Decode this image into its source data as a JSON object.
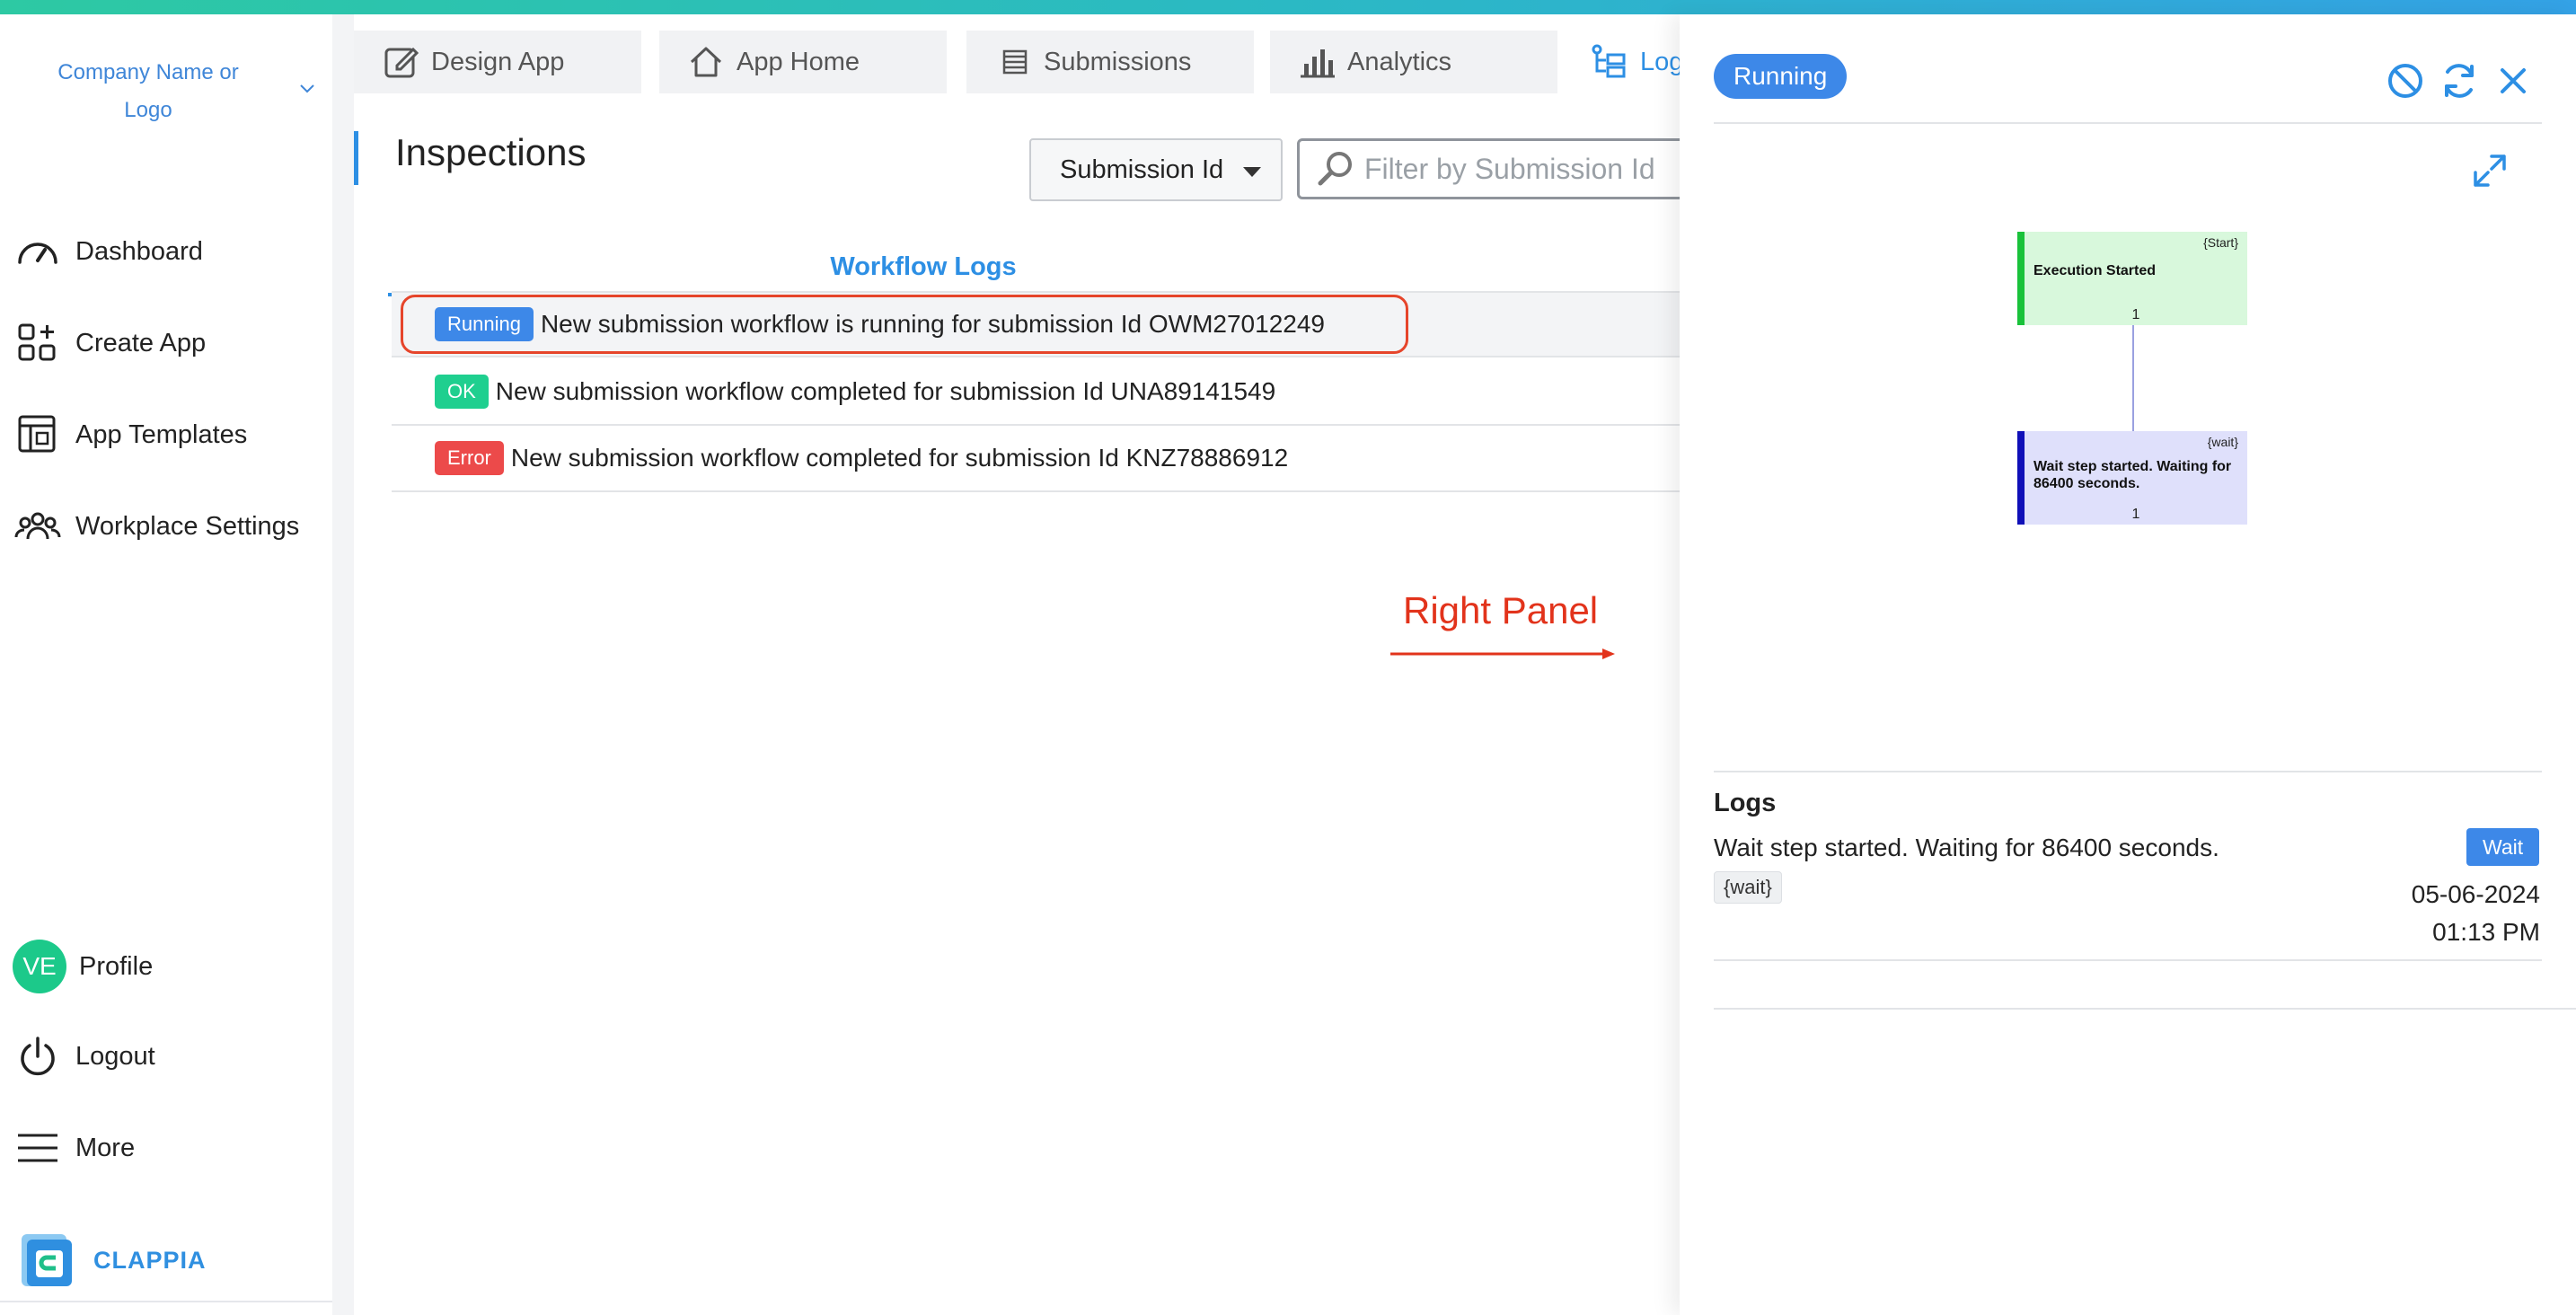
{
  "colors": {
    "accent": "#2d8fe4",
    "running": "#3d88e8",
    "ok": "#1fcf8f",
    "error": "#ec4a4a",
    "annotation": "#e2331b",
    "brand": "#2f8fe0"
  },
  "sidebar": {
    "company": "Company Name or Logo",
    "items": [
      {
        "label": "Dashboard",
        "icon": "gauge-icon"
      },
      {
        "label": "Create App",
        "icon": "apps-add-icon"
      },
      {
        "label": "App Templates",
        "icon": "template-icon"
      },
      {
        "label": "Workplace Settings",
        "icon": "users-icon"
      }
    ],
    "profile": {
      "initials": "VE",
      "label": "Profile"
    },
    "logout": "Logout",
    "more": "More",
    "brand": "CLAPPIA"
  },
  "tabs": [
    {
      "label": "Design App",
      "icon": "edit-icon"
    },
    {
      "label": "App Home",
      "icon": "home-icon"
    },
    {
      "label": "Submissions",
      "icon": "list-icon"
    },
    {
      "label": "Analytics",
      "icon": "bar-chart-icon"
    },
    {
      "label": "Logs",
      "icon": "workflow-icon"
    }
  ],
  "main": {
    "title": "Inspections",
    "filter_field": "Submission Id",
    "search_placeholder": "Filter by Submission Id",
    "subtab": "Workflow Logs",
    "rows": [
      {
        "status": "Running",
        "text": "New submission workflow is running for submission Id OWM27012249"
      },
      {
        "status": "OK",
        "text": "New submission workflow completed for submission Id UNA89141549"
      },
      {
        "status": "Error",
        "text": "New submission workflow completed for submission Id KNZ78886912"
      }
    ],
    "annotation": "Right Panel"
  },
  "panel": {
    "status": "Running",
    "nodes": [
      {
        "tag": "{Start}",
        "title": "Execution Started",
        "count": "1"
      },
      {
        "tag": "{wait}",
        "title": "Wait step started. Waiting for 86400 seconds.",
        "count": "1"
      }
    ],
    "logs_title": "Logs",
    "log": {
      "message": "Wait step started. Waiting for 86400 seconds.",
      "badge": "Wait",
      "key": "{wait}",
      "date": "05-06-2024",
      "time": "01:13 PM"
    }
  }
}
